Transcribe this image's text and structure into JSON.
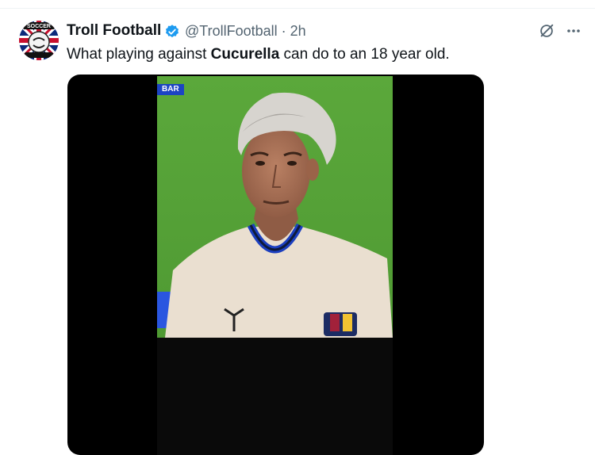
{
  "tweet": {
    "author": "Troll Football",
    "handle": "@TrollFootball",
    "time": "2h",
    "handle_time_sep": " · ",
    "text_before": "What playing against ",
    "text_bold": "Cucurella",
    "text_after": " can do to an 18 year old."
  },
  "avatar": {
    "logo_text": "SOCCER"
  },
  "video": {
    "score_label": "BAR"
  },
  "colors": {
    "verified": "#1d9bf0",
    "secondary_text": "#536471",
    "pitch_green": "#5aa33a",
    "kit_blue": "#1c44c4"
  },
  "icons": [
    "grok-icon",
    "more-icon",
    "verified-badge-icon"
  ]
}
